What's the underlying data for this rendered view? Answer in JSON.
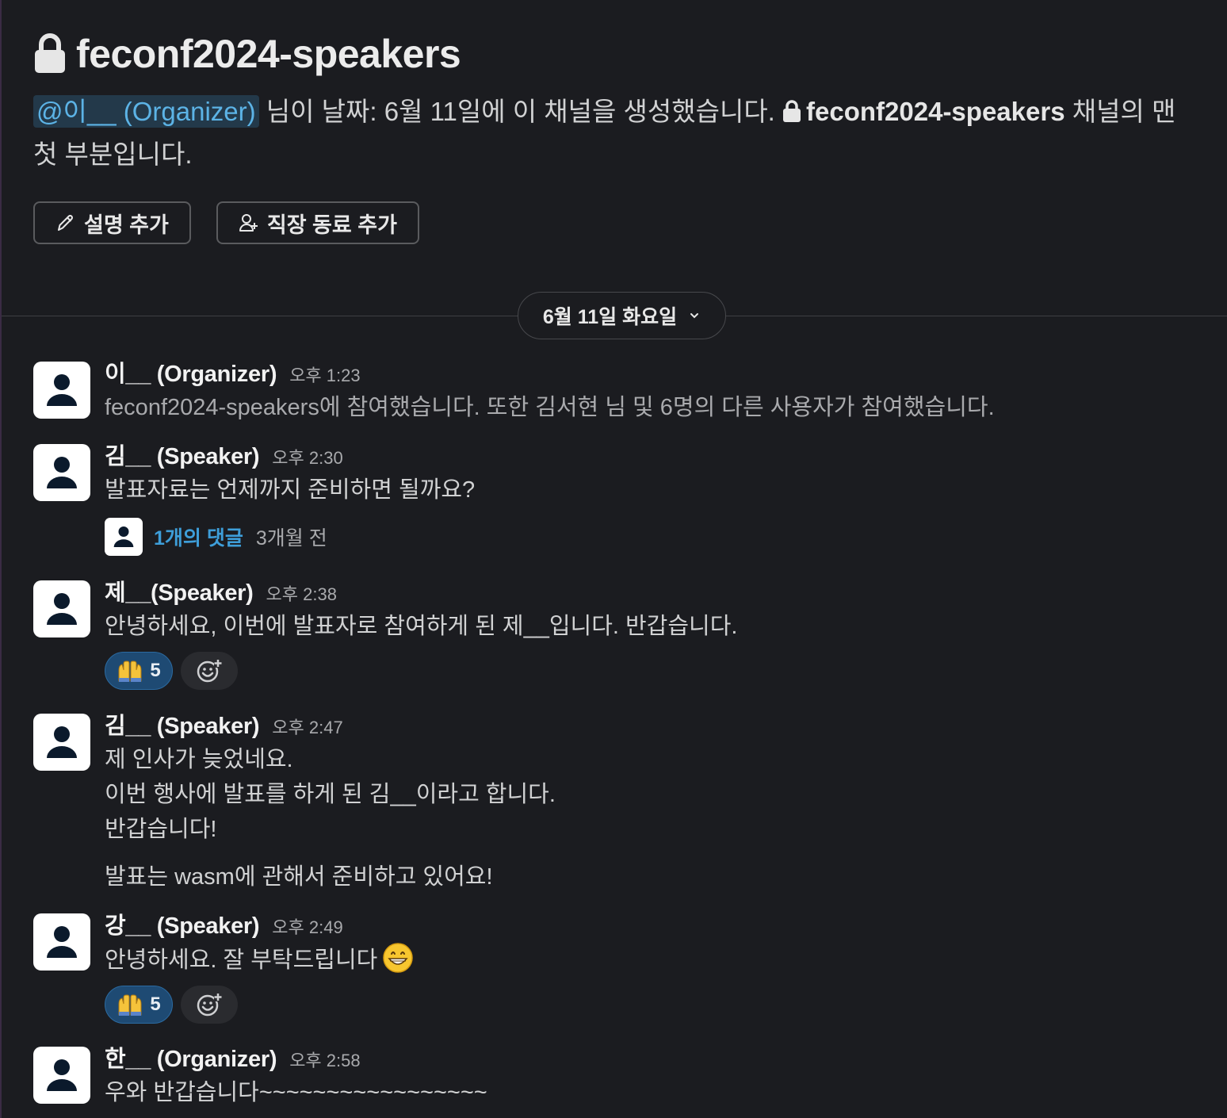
{
  "channel": {
    "name": "feconf2024-speakers",
    "lock_icon": "lock-icon"
  },
  "intro": {
    "mention": "@이__ (Organizer)",
    "text_before_channel": " 님이 날짜: 6월 11일에 이 채널을 생성했습니다. ",
    "channel_name": "feconf2024-speakers",
    "text_after_channel": " 채널의 맨 첫 부분입니다.",
    "buttons": {
      "add_description": "설명 추가",
      "add_coworkers": "직장 동료 추가"
    }
  },
  "date_divider": {
    "label": "6월 11일 화요일"
  },
  "messages": [
    {
      "sender": "이__ (Organizer)",
      "time": "오후 1:23",
      "text": "feconf2024-speakers에 참여했습니다. 또한 김서현 님 및 6명의 다른 사용자가 참여했습니다."
    },
    {
      "sender": "김__ (Speaker)",
      "time": "오후 2:30",
      "text": "발표자료는 언제까지 준비하면 될까요?",
      "thread": {
        "reply_count": "1개의 댓글",
        "reply_time": "3개월 전"
      }
    },
    {
      "sender": "제__(Speaker)",
      "time": "오후 2:38",
      "text": "안녕하세요, 이번에 발표자로 참여하게 된 제__입니다. 반갑습니다.",
      "reaction": {
        "emoji": "raised-hands",
        "count": "5"
      }
    },
    {
      "sender": "김__ (Speaker)",
      "time": "오후 2:47",
      "lines": [
        "제 인사가 늦었네요.",
        "이번 행사에 발표를 하게 된 김__이라고 합니다.",
        "반갑습니다!"
      ],
      "paragraph2": "발표는 wasm에 관해서 준비하고 있어요!"
    },
    {
      "sender": "강__ (Speaker)",
      "time": "오후 2:49",
      "text": "안녕하세요. 잘 부탁드립니다",
      "inline_emoji": "grinning-face",
      "reaction": {
        "emoji": "raised-hands",
        "count": "5"
      }
    },
    {
      "sender": "한__ (Organizer)",
      "time": "오후 2:58",
      "text": "우와 반갑습니다~~~~~~~~~~~~~~~~~"
    }
  ],
  "colors": {
    "background": "#1b1c20",
    "mention_bg": "#23394a",
    "link": "#3e9ed9",
    "reaction_bg": "#1e4a73"
  }
}
